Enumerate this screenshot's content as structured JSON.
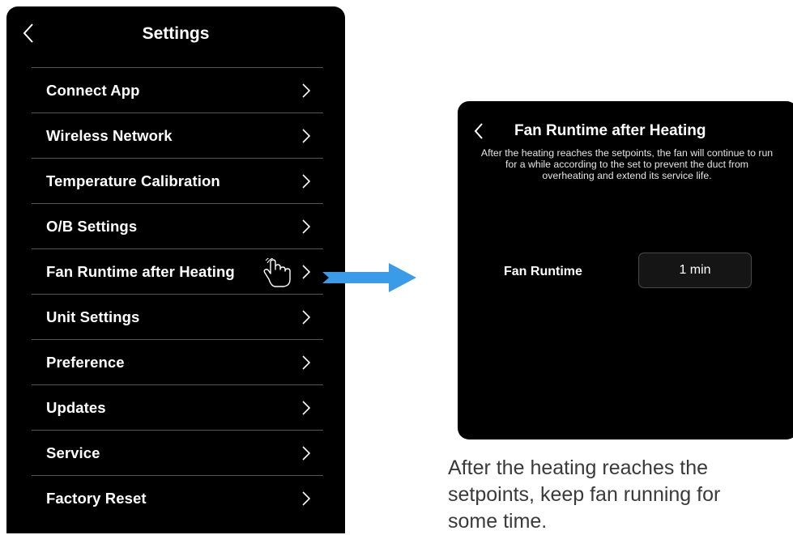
{
  "left_screen": {
    "title": "Settings",
    "menu": [
      {
        "label": "Connect App"
      },
      {
        "label": "Wireless Network"
      },
      {
        "label": "Temperature Calibration"
      },
      {
        "label": "O/B Settings"
      },
      {
        "label": "Fan Runtime after Heating"
      },
      {
        "label": "Unit Settings"
      },
      {
        "label": "Preference"
      },
      {
        "label": "Updates"
      },
      {
        "label": "Service"
      },
      {
        "label": "Factory Reset"
      }
    ],
    "pointer_icon": "hand-pointer-icon",
    "highlighted_item": "Fan Runtime after Heating"
  },
  "right_screen": {
    "title": "Fan Runtime after Heating",
    "description": "After the heating reaches the setpoints, the fan will continue to run for a while according to the set to prevent the duct from overheating and extend its service life.",
    "field_label": "Fan Runtime",
    "field_value": "1 min"
  },
  "caption": "After the heating reaches the\nsetpoints, keep fan running for\nsome time.",
  "colors": {
    "screen_bg": "#000000",
    "arrow": "#3a9be8",
    "caption": "#3a3a3a"
  }
}
